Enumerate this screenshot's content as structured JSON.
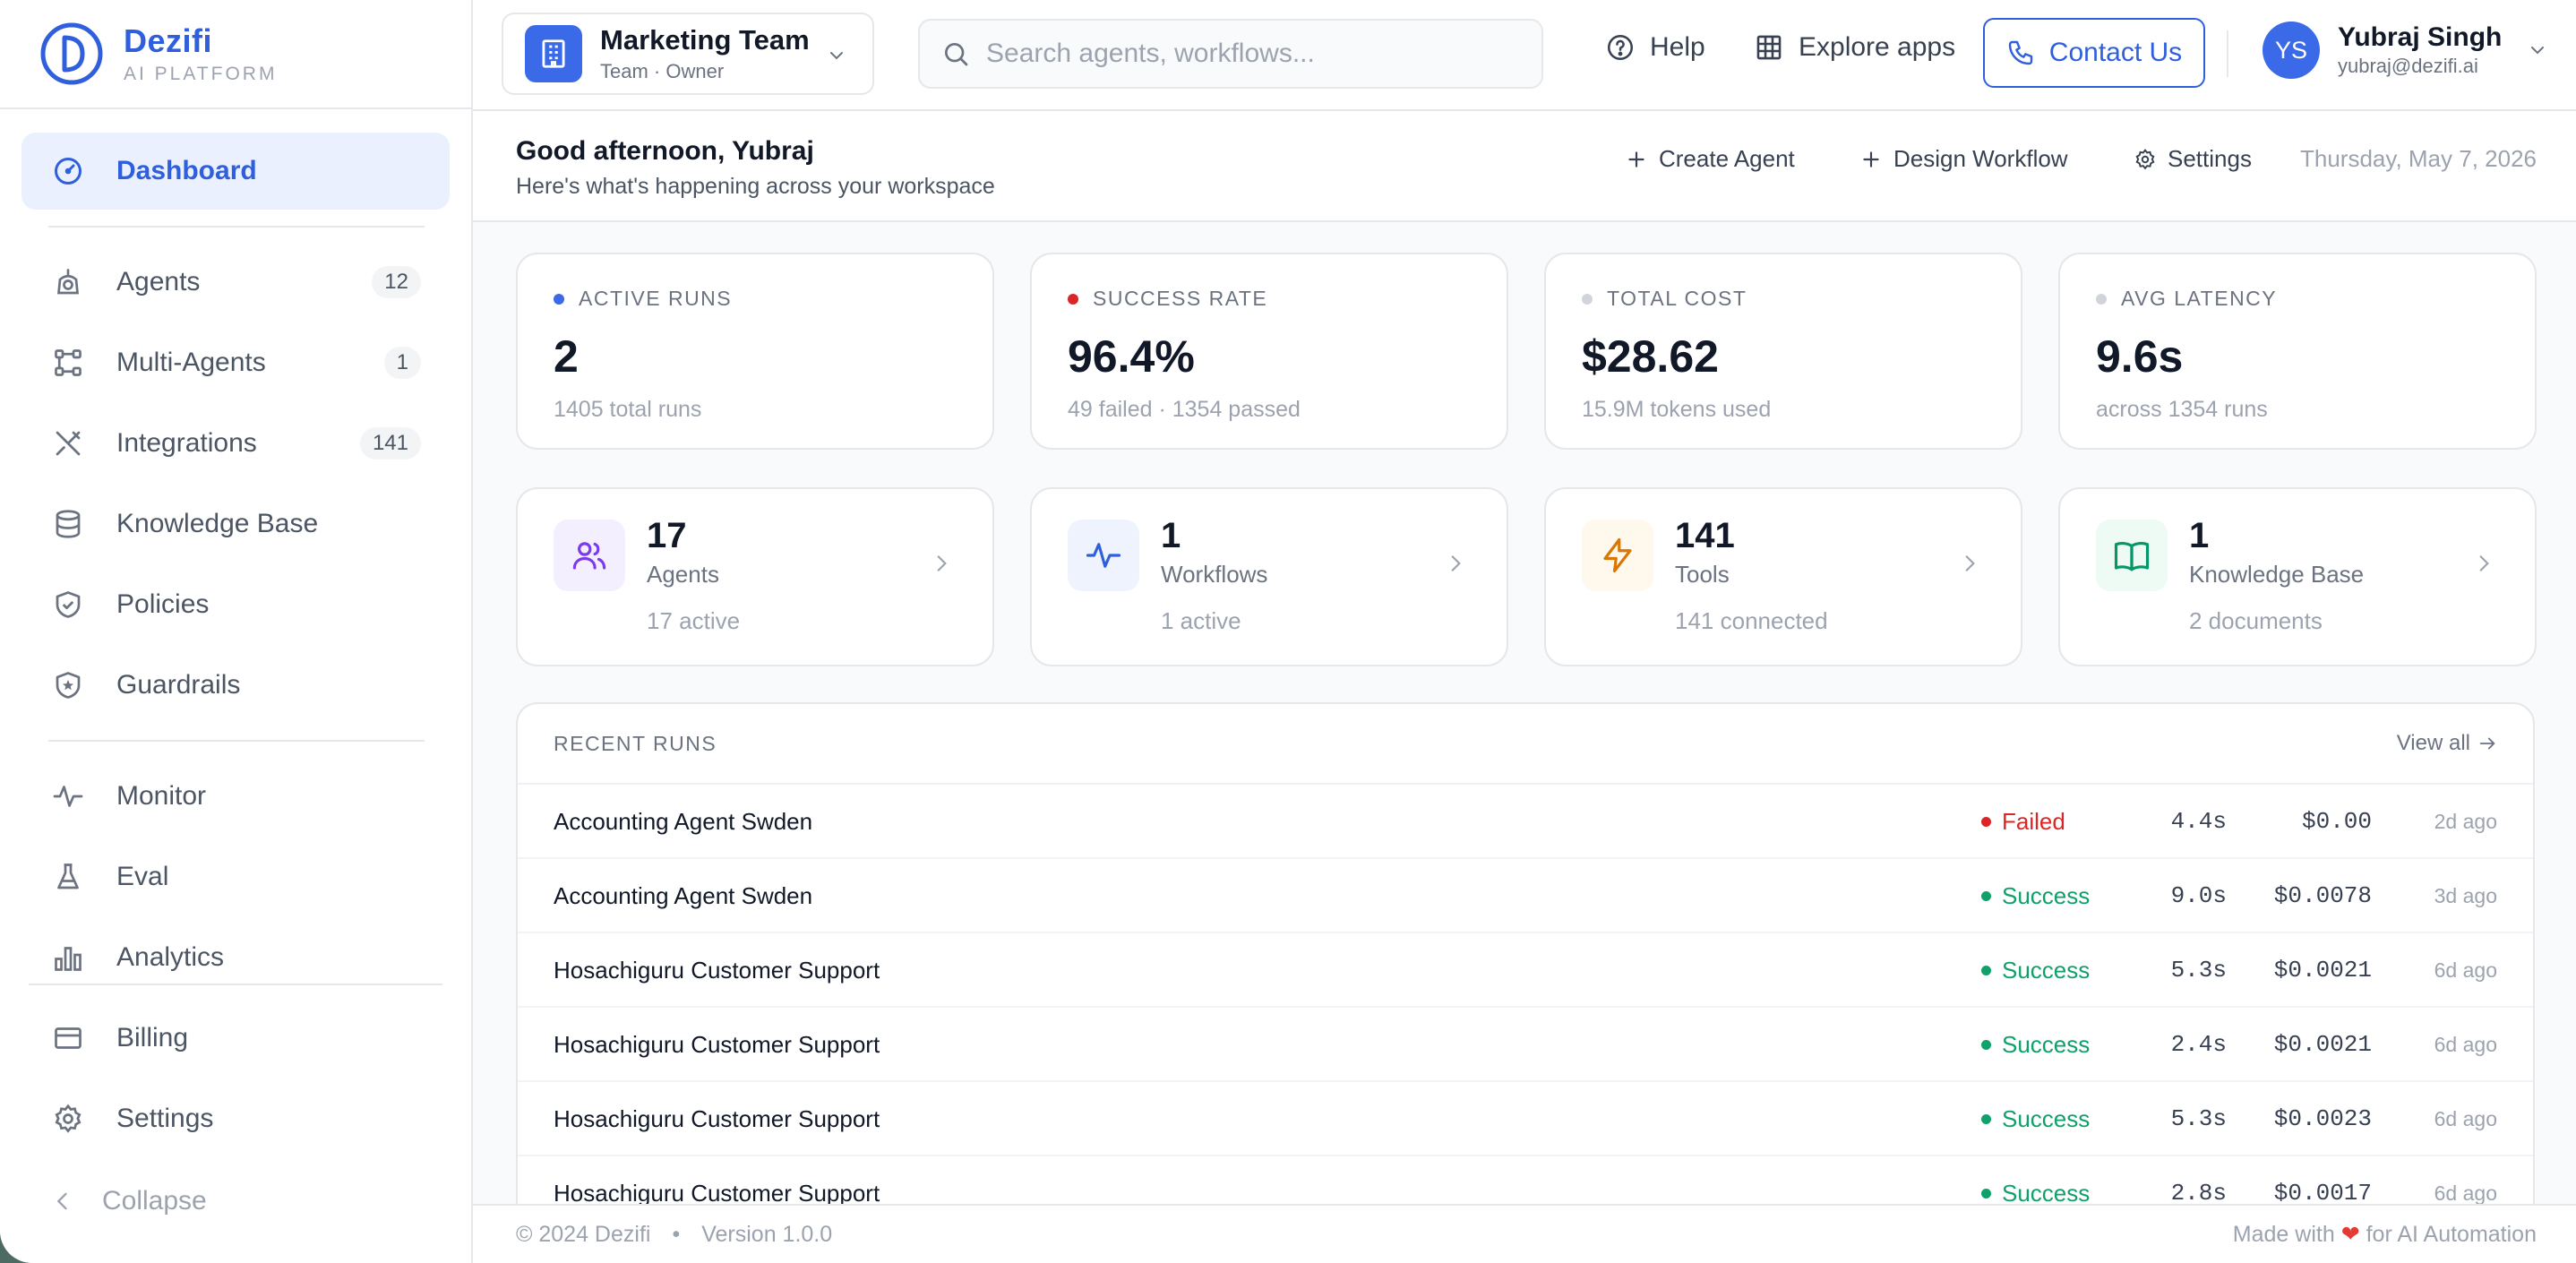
{
  "brand": {
    "name": "Dezifi",
    "sub": "AI PLATFORM"
  },
  "sidebar": {
    "items": [
      {
        "label": "Dashboard",
        "icon": "gauge-icon",
        "active": true
      },
      {
        "label": "Agents",
        "icon": "robot-icon",
        "badge": "12"
      },
      {
        "label": "Multi-Agents",
        "icon": "network-icon",
        "badge": "1"
      },
      {
        "label": "Integrations",
        "icon": "tools-icon",
        "badge": "141"
      },
      {
        "label": "Knowledge Base",
        "icon": "database-icon"
      },
      {
        "label": "Policies",
        "icon": "shield-check-icon"
      },
      {
        "label": "Guardrails",
        "icon": "shield-star-icon"
      },
      {
        "label": "Monitor",
        "icon": "activity-icon"
      },
      {
        "label": "Eval",
        "icon": "flask-icon"
      },
      {
        "label": "Analytics",
        "icon": "bar-chart-icon"
      },
      {
        "label": "Billing",
        "icon": "wallet-icon"
      },
      {
        "label": "Settings",
        "icon": "gear-icon"
      }
    ],
    "collapse_label": "Collapse"
  },
  "header": {
    "team_name": "Marketing Team",
    "team_role": "Team · Owner",
    "search_placeholder": "Search agents, workflows...",
    "help_label": "Help",
    "explore_label": "Explore apps",
    "contact_label": "Contact Us",
    "user_initials": "YS",
    "user_name": "Yubraj Singh",
    "user_email": "yubraj@dezifi.ai"
  },
  "subheader": {
    "greeting": "Good afternoon, Yubraj",
    "subtitle": "Here's what's happening across your workspace",
    "create_agent": "Create Agent",
    "design_workflow": "Design Workflow",
    "settings": "Settings",
    "date": "Thursday, May 7, 2026"
  },
  "stats": [
    {
      "label": "ACTIVE RUNS",
      "value": "2",
      "sub": "1405 total runs",
      "dot_color": "#3b6ae8"
    },
    {
      "label": "SUCCESS RATE",
      "value": "96.4%",
      "sub": "49 failed · 1354 passed",
      "dot_color": "#dc2626"
    },
    {
      "label": "TOTAL COST",
      "value": "$28.62",
      "sub": "15.9M tokens used",
      "dot_color": "#d1d5db"
    },
    {
      "label": "AVG LATENCY",
      "value": "9.6s",
      "sub": "across 1354 runs",
      "dot_color": "#d1d5db"
    }
  ],
  "resources": [
    {
      "num": "17",
      "name": "Agents",
      "sub": "17 active",
      "icon": "users-icon",
      "color": "#7c3aed",
      "bg": "#f3efff"
    },
    {
      "num": "1",
      "name": "Workflows",
      "sub": "1 active",
      "icon": "activity-icon",
      "color": "#2f5fdc",
      "bg": "#eef3fd"
    },
    {
      "num": "141",
      "name": "Tools",
      "sub": "141 connected",
      "icon": "lightning-icon",
      "color": "#d97706",
      "bg": "#fff8ec"
    },
    {
      "num": "1",
      "name": "Knowledge Base",
      "sub": "2 documents",
      "icon": "book-icon",
      "color": "#059669",
      "bg": "#eefaf4"
    }
  ],
  "runs": {
    "title": "RECENT RUNS",
    "view_all": "View all",
    "rows": [
      {
        "name": "Accounting Agent Swden",
        "status": "Failed",
        "duration": "4.4s",
        "cost": "$0.00",
        "ago": "2d ago"
      },
      {
        "name": "Accounting Agent Swden",
        "status": "Success",
        "duration": "9.0s",
        "cost": "$0.0078",
        "ago": "3d ago"
      },
      {
        "name": "Hosachiguru Customer Support",
        "status": "Success",
        "duration": "5.3s",
        "cost": "$0.0021",
        "ago": "6d ago"
      },
      {
        "name": "Hosachiguru Customer Support",
        "status": "Success",
        "duration": "2.4s",
        "cost": "$0.0021",
        "ago": "6d ago"
      },
      {
        "name": "Hosachiguru Customer Support",
        "status": "Success",
        "duration": "5.3s",
        "cost": "$0.0023",
        "ago": "6d ago"
      },
      {
        "name": "Hosachiguru Customer Support",
        "status": "Success",
        "duration": "2.8s",
        "cost": "$0.0017",
        "ago": "6d ago"
      }
    ]
  },
  "footer": {
    "copyright": "© 2024 Dezifi",
    "version": "Version 1.0.0",
    "made_with": "Made with",
    "made_for": "for AI Automation"
  },
  "colors": {
    "accent": "#2f5fdc",
    "success": "#10a06a",
    "failed": "#dc2626"
  }
}
